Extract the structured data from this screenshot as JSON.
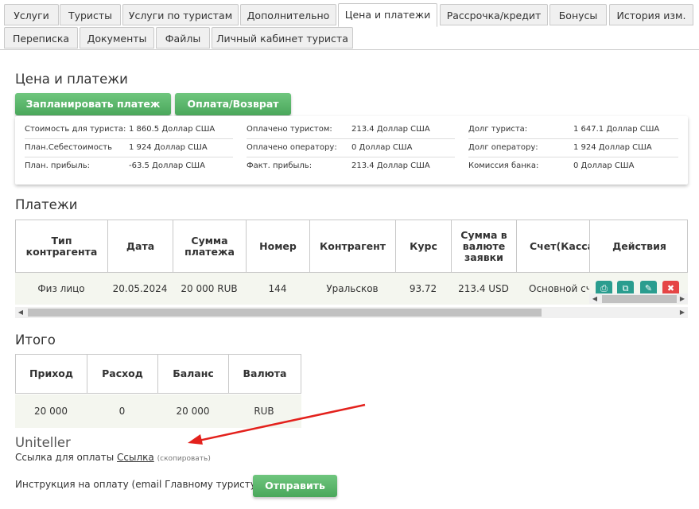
{
  "tabs": [
    "Услуги",
    "Туристы",
    "Услуги по туристам",
    "Дополнительно",
    "Цена и платежи",
    "Рассрочка/кредит",
    "Бонусы",
    "История изм.",
    "Переписка",
    "Документы",
    "Файлы",
    "Личный кабинет туриста"
  ],
  "price": {
    "title": "Цена и платежи",
    "btn_plan": "Запланировать платеж",
    "btn_pay": "Оплата/Возврат",
    "rows": [
      [
        [
          "Стоимость для туриста:",
          "1 860.5 Доллар США"
        ],
        [
          "Оплачено туристом:",
          "213.4 Доллар США"
        ],
        [
          "Долг туриста:",
          "1 647.1 Доллар США"
        ]
      ],
      [
        [
          "План.Себестоимость",
          "1 924 Доллар США"
        ],
        [
          "Оплачено оператору:",
          "0 Доллар США"
        ],
        [
          "Долг оператору:",
          "1 924 Доллар США"
        ]
      ],
      [
        [
          "План. прибыль:",
          "-63.5 Доллар США"
        ],
        [
          "Факт. прибыль:",
          "213.4 Доллар США"
        ],
        [
          "Комиссия банка:",
          "0 Доллар США"
        ]
      ]
    ]
  },
  "payments": {
    "title": "Платежи",
    "headers": [
      "Тип контрагента",
      "Дата",
      "Сумма платежа",
      "Номер",
      "Контрагент",
      "Курс",
      "Сумма в валюте заявки",
      "Счет(Касса",
      "Действия"
    ],
    "row": [
      "Физ лицо",
      "20.05.2024",
      "20 000 RUB",
      "144",
      "Уральсков",
      "93.72",
      "213.4 USD",
      "Основной сче"
    ]
  },
  "totals": {
    "title": "Итого",
    "headers": [
      "Приход",
      "Расход",
      "Баланс",
      "Валюта"
    ],
    "row": [
      "20 000",
      "0",
      "20 000",
      "RUB"
    ]
  },
  "uniteller": {
    "title": "Uniteller",
    "link_label": "Ссылка для оплаты",
    "link_text": "Ссылка",
    "copy_text": "(скопировать)",
    "instruction": "Инструкция на оплату (email Главному туристу)",
    "send_btn": "Отправить"
  },
  "colors": {
    "accent_green": "#4aa75b",
    "arrow_red": "#e3211c"
  }
}
